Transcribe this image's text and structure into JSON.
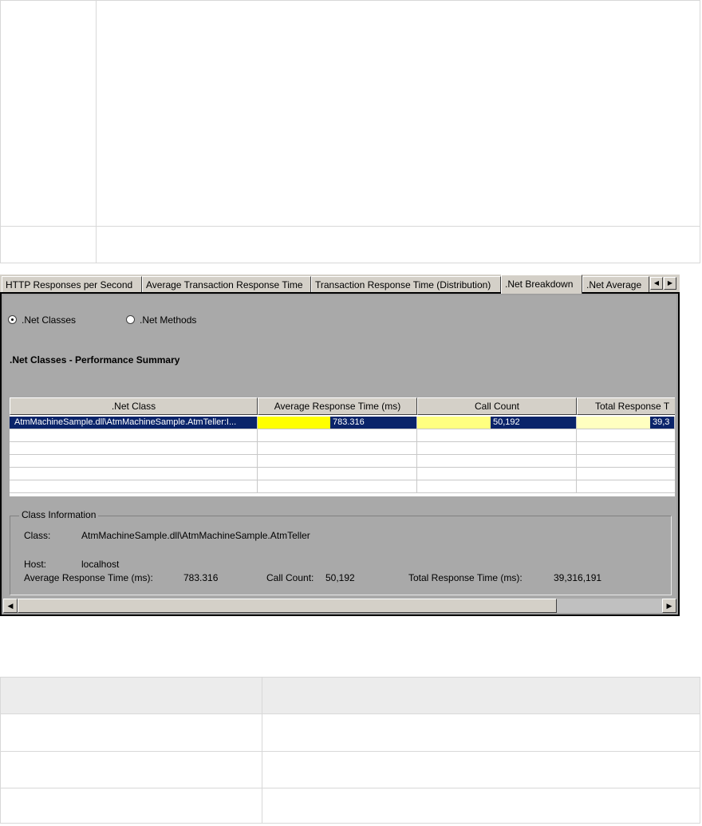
{
  "tabs": [
    {
      "label": "HTTP Responses per Second"
    },
    {
      "label": "Average Transaction Response Time"
    },
    {
      "label": "Transaction Response Time (Distribution)"
    },
    {
      "label": ".Net Breakdown"
    },
    {
      "label": ".Net Average"
    }
  ],
  "radios": {
    "classes": ".Net Classes",
    "methods": ".Net Methods",
    "selected": "classes"
  },
  "summary_title": ".Net Classes - Performance Summary",
  "grid": {
    "columns": [
      ".Net Class",
      "Average Response Time (ms)",
      "Call Count",
      "Total Response T"
    ],
    "row": {
      "net_class": "AtmMachineSample.dll\\AtmMachineSample.AtmTeller:I...",
      "avg_response": "783.316",
      "call_count": "50,192",
      "total_response": "39,3"
    }
  },
  "class_info": {
    "legend": "Class Information",
    "class_label": "Class:",
    "class_value": "AtmMachineSample.dll\\AtmMachineSample.AtmTeller",
    "host_label": "Host:",
    "host_value": "localhost",
    "avg_label": "Average Response Time (ms):",
    "avg_value": "783.316",
    "count_label": "Call Count:",
    "count_value": "50,192",
    "total_label": "Total Response Time (ms):",
    "total_value": "39,316,191"
  },
  "colors": {
    "selection": "#0a246a",
    "bar_bright": "#ffff00",
    "bar_mid": "#ffff80",
    "bar_light": "#ffffc0"
  }
}
